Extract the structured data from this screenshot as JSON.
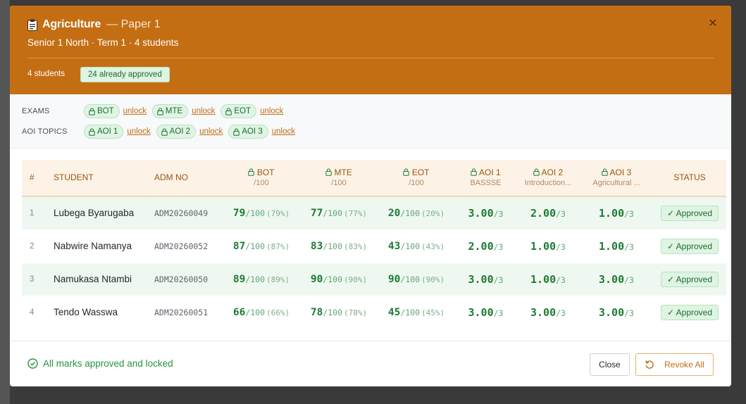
{
  "header": {
    "subject": "Agriculture",
    "paper": "— Paper 1",
    "subtitle": "Senior 1 North · Term 1 · 4 students",
    "student_count": "4 students",
    "approved_badge": "24 already approved"
  },
  "locks": {
    "exams_label": "EXAMS",
    "aoi_label": "AOI TOPICS",
    "unlock_label": "unlock",
    "exams": [
      "BOT",
      "MTE",
      "EOT"
    ],
    "aoi": [
      "AOI 1",
      "AOI 2",
      "AOI 3"
    ]
  },
  "table": {
    "headers": {
      "idx": "#",
      "student": "STUDENT",
      "adm": "ADM NO",
      "bot": "BOT",
      "bot_sub": "/100",
      "mte": "MTE",
      "mte_sub": "/100",
      "eot": "EOT",
      "eot_sub": "/100",
      "aoi1": "AOI 1",
      "aoi1_sub": "BASSSE",
      "aoi2": "AOI 2",
      "aoi2_sub": "Introduction...",
      "aoi3": "AOI 3",
      "aoi3_sub": "Agricultural ...",
      "status": "STATUS"
    },
    "rows": [
      {
        "idx": "1",
        "name": "Lubega Byarugaba",
        "adm": "ADM20260049",
        "bot": "79",
        "bot_pct": "(79%)",
        "mte": "77",
        "mte_pct": "(77%)",
        "eot": "20",
        "eot_pct": "(20%)",
        "aoi1": "3.00",
        "aoi2": "2.00",
        "aoi3": "1.00",
        "status": "✓ Approved"
      },
      {
        "idx": "2",
        "name": "Nabwire Namanya",
        "adm": "ADM20260052",
        "bot": "87",
        "bot_pct": "(87%)",
        "mte": "83",
        "mte_pct": "(83%)",
        "eot": "43",
        "eot_pct": "(43%)",
        "aoi1": "2.00",
        "aoi2": "1.00",
        "aoi3": "1.00",
        "status": "✓ Approved"
      },
      {
        "idx": "3",
        "name": "Namukasa Ntambi",
        "adm": "ADM20260050",
        "bot": "89",
        "bot_pct": "(89%)",
        "mte": "90",
        "mte_pct": "(90%)",
        "eot": "90",
        "eot_pct": "(90%)",
        "aoi1": "3.00",
        "aoi2": "1.00",
        "aoi3": "3.00",
        "status": "✓ Approved"
      },
      {
        "idx": "4",
        "name": "Tendo Wasswa",
        "adm": "ADM20260051",
        "bot": "66",
        "bot_pct": "(66%)",
        "mte": "78",
        "mte_pct": "(78%)",
        "eot": "45",
        "eot_pct": "(45%)",
        "aoi1": "3.00",
        "aoi2": "3.00",
        "aoi3": "3.00",
        "status": "✓ Approved"
      }
    ],
    "exam_denom": "/100",
    "aoi_denom": "/3"
  },
  "footer": {
    "message": "All marks approved and locked",
    "close_label": "Close",
    "revoke_label": "Revoke All"
  }
}
